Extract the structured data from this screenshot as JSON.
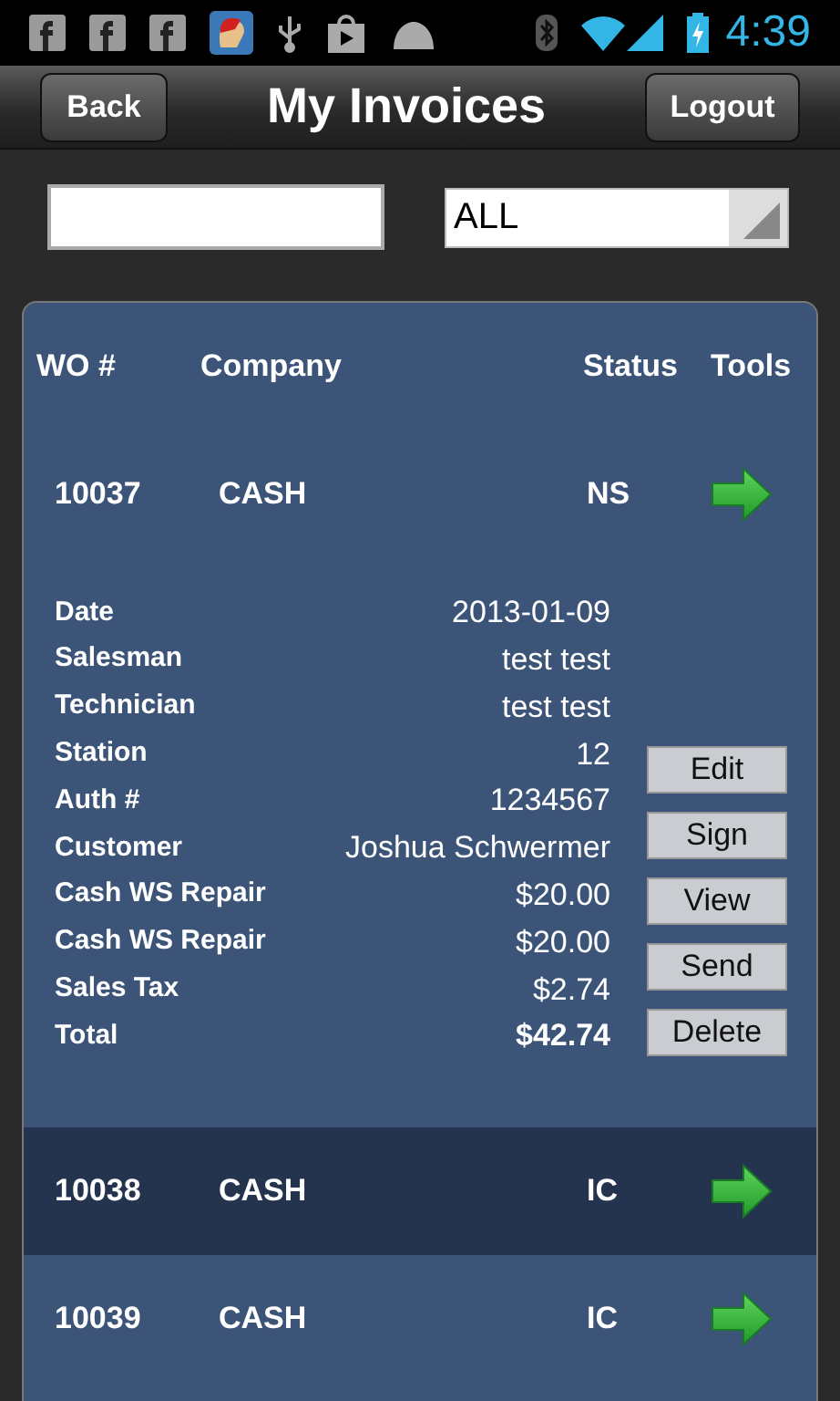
{
  "status_bar": {
    "time": "4:39"
  },
  "header": {
    "title": "My Invoices",
    "back_button": "Back",
    "logout_button": "Logout"
  },
  "filters": {
    "status_select": {
      "value": "ALL"
    }
  },
  "table": {
    "columns": [
      "WO #",
      "Company",
      "Status",
      "Tools"
    ],
    "rows": [
      {
        "wo": "10037",
        "company": "CASH",
        "status": "NS",
        "selected": false,
        "details": [
          {
            "label": "Date",
            "value": "2013-01-09",
            "bold": false
          },
          {
            "label": "Salesman",
            "value": "test test",
            "bold": false
          },
          {
            "label": "Technician",
            "value": "test test",
            "bold": false
          },
          {
            "label": "Station",
            "value": "12",
            "bold": false
          },
          {
            "label": "Auth #",
            "value": "1234567",
            "bold": false
          },
          {
            "label": "Customer",
            "value": "Joshua Schwermer",
            "bold": false
          },
          {
            "label": "Cash WS Repair",
            "value": "$20.00",
            "bold": false
          },
          {
            "label": "Cash WS Repair",
            "value": "$20.00",
            "bold": false
          },
          {
            "label": "Sales Tax",
            "value": "$2.74",
            "bold": false
          },
          {
            "label": "Total",
            "value": "$42.74",
            "bold": true
          }
        ],
        "actions": [
          "Edit",
          "Sign",
          "View",
          "Send",
          "Delete"
        ]
      },
      {
        "wo": "10038",
        "company": "CASH",
        "status": "IC",
        "selected": true
      },
      {
        "wo": "10039",
        "company": "CASH",
        "status": "IC",
        "selected": false
      }
    ]
  }
}
